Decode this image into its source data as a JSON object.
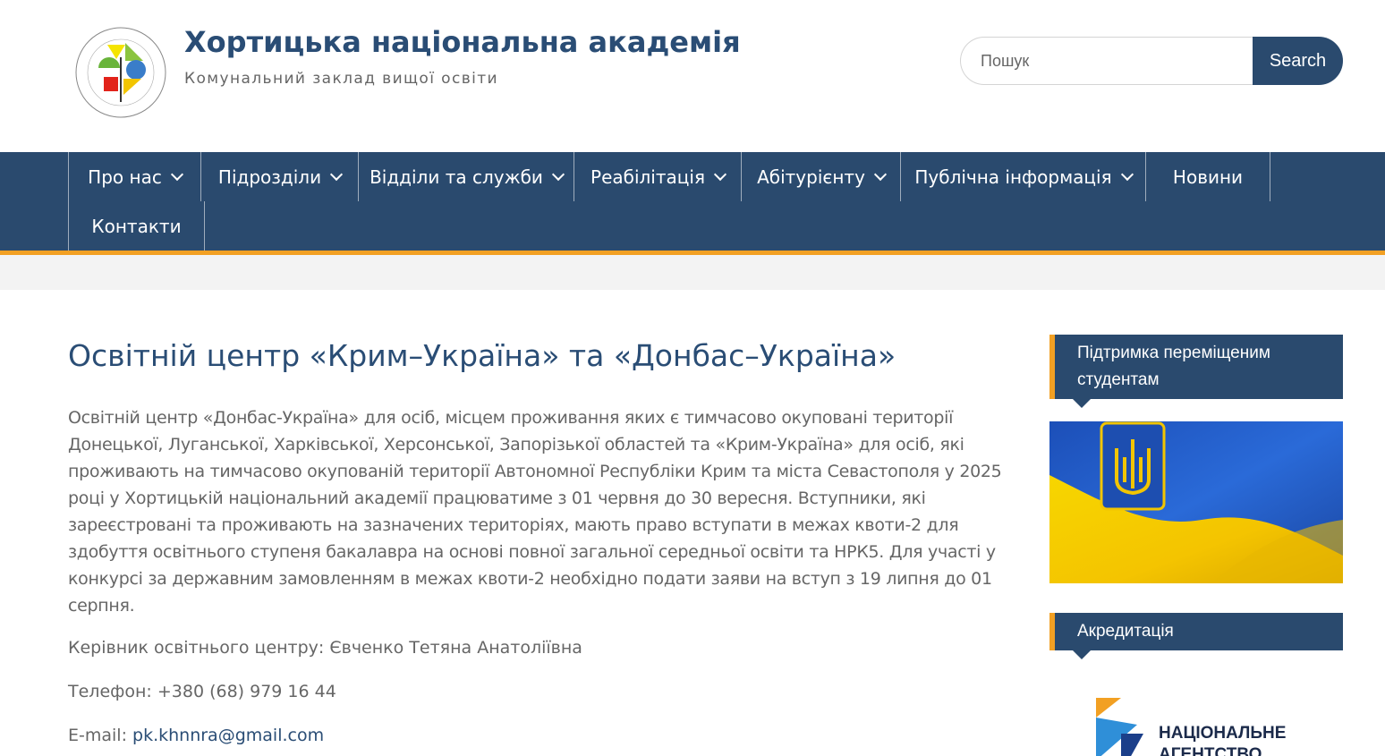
{
  "header": {
    "site_title": "Хортицька національна академія",
    "site_description": "Комунальний заклад вищої освіти",
    "logo_name": "academy-logo",
    "search": {
      "placeholder": "Пошук",
      "button_label": "Search"
    }
  },
  "nav": {
    "items": [
      {
        "label": "Про нас",
        "has_dropdown": true
      },
      {
        "label": "Підрозділи",
        "has_dropdown": true
      },
      {
        "label": "Відділи та служби",
        "has_dropdown": true
      },
      {
        "label": "Реабілітація",
        "has_dropdown": true
      },
      {
        "label": "Абітурієнту",
        "has_dropdown": true
      },
      {
        "label": "Публічна інформація",
        "has_dropdown": true
      },
      {
        "label": "Новини",
        "has_dropdown": false
      },
      {
        "label": "Контакти",
        "has_dropdown": false
      }
    ]
  },
  "main": {
    "title": "Освітній центр «Крим–Україна» та «Донбас–Україна»",
    "paragraph": "Освітній центр «Донбас-Україна» для осіб, місцем проживання яких є тимчасово окуповані території Донецької, Луганської, Харківської, Херсонської, Запорізької областей та «Крим-Україна» для осіб, які проживають на тимчасово окупованій території Автономної Республіки Крим та міста Севастополя у 2025 році у Хортицькій національний академії працюватиме з 01 червня до 30 вересня. Вступники, які зареєстровані та проживають на зазначених територіях, мають право вступати в межах квоти-2 для здобуття освітнього ступеня бакалавра на основі повної загальної середньої освіти та НРК5. Для участі у конкурсі за державним замовленням в межах квоти-2 необхідно подати заяви на вступ з 19 липня до 01 серпня.",
    "head_label": "Керівник освітнього центру: Євченко Тетяна Анатоліївна",
    "phone_label": "Телефон:  +380 (68) 979 16 44",
    "email_label": "E-mail: ",
    "email_value": "pk.khnnra@gmail.com"
  },
  "sidebar": {
    "widget1_title": "Підтримка переміщеним студентам",
    "widget2_title": "Акредитація",
    "accreditation_text_line1": "НАЦІОНАЛЬНЕ",
    "accreditation_text_line2": "АГЕНТСТВО"
  },
  "colors": {
    "primary": "#2a4a6e",
    "accent": "#f2a023",
    "title": "#2a4d75",
    "band": "#f3f3f3"
  }
}
